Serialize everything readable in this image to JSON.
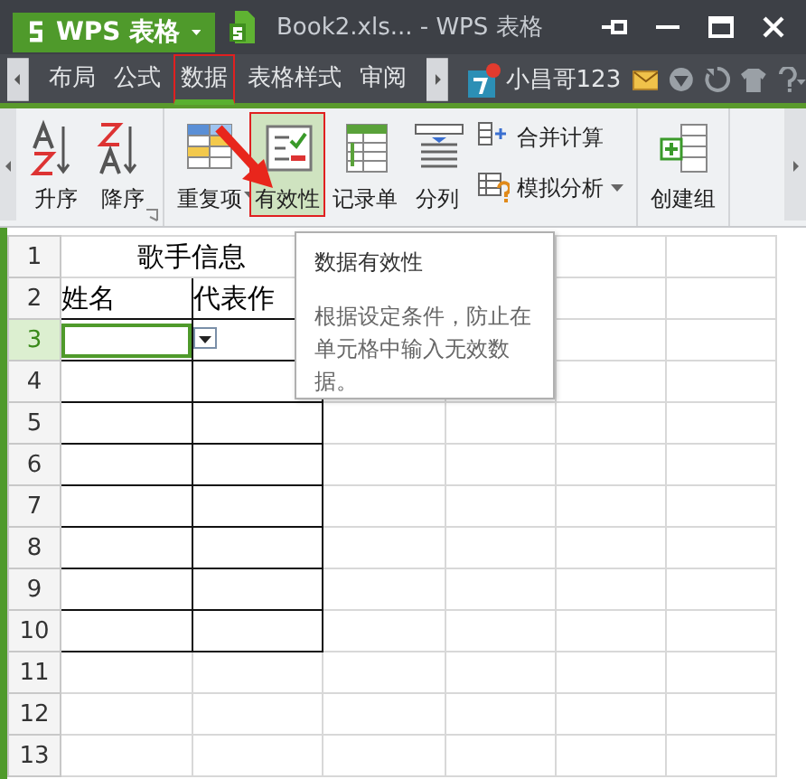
{
  "window": {
    "app_menu": "WPS 表格",
    "title": "Book2.xls... - WPS 表格"
  },
  "tabs": [
    {
      "label": "布局",
      "selected": false
    },
    {
      "label": "公式",
      "selected": false
    },
    {
      "label": "数据",
      "selected": true
    },
    {
      "label": "表格样式",
      "selected": false
    },
    {
      "label": "审阅",
      "selected": false
    }
  ],
  "account": {
    "user": "小昌哥123"
  },
  "ribbon": {
    "groups": [
      [
        {
          "label": "升序",
          "kind": "large",
          "selected": false,
          "dropdown": false
        },
        {
          "label": "降序",
          "kind": "large",
          "selected": false,
          "dropdown": false
        }
      ],
      [
        {
          "label": "重复项",
          "kind": "large",
          "selected": false,
          "dropdown": true
        },
        {
          "label": "有效性",
          "kind": "large",
          "selected": true,
          "dropdown": false
        },
        {
          "label": "记录单",
          "kind": "large",
          "selected": false,
          "dropdown": false
        },
        {
          "label": "分列",
          "kind": "large",
          "selected": false,
          "dropdown": false
        },
        {
          "label": "合并计算",
          "kind": "small",
          "selected": false,
          "dropdown": false
        },
        {
          "label": "模拟分析",
          "kind": "small",
          "selected": false,
          "dropdown": true
        }
      ],
      [
        {
          "label": "创建组",
          "kind": "large",
          "selected": false,
          "dropdown": false
        }
      ]
    ]
  },
  "sheet": {
    "title": "歌手信息",
    "columns": [
      "姓名",
      "代表作"
    ],
    "rows": [
      {
        "label": "1",
        "selected": false,
        "bordered": false
      },
      {
        "label": "2",
        "selected": false,
        "bordered": true
      },
      {
        "label": "3",
        "selected": true,
        "bordered": true
      },
      {
        "label": "4",
        "selected": false,
        "bordered": true
      },
      {
        "label": "5",
        "selected": false,
        "bordered": true
      },
      {
        "label": "6",
        "selected": false,
        "bordered": true
      },
      {
        "label": "7",
        "selected": false,
        "bordered": true
      },
      {
        "label": "8",
        "selected": false,
        "bordered": true
      },
      {
        "label": "9",
        "selected": false,
        "bordered": true
      },
      {
        "label": "10",
        "selected": false,
        "bordered": true
      },
      {
        "label": "11",
        "selected": false,
        "bordered": false
      },
      {
        "label": "12",
        "selected": false,
        "bordered": false
      },
      {
        "label": "13",
        "selected": false,
        "bordered": false
      }
    ]
  },
  "tooltip": {
    "title": "数据有效性",
    "text": "根据设定条件，防止在单元格中输入无效数据。"
  }
}
